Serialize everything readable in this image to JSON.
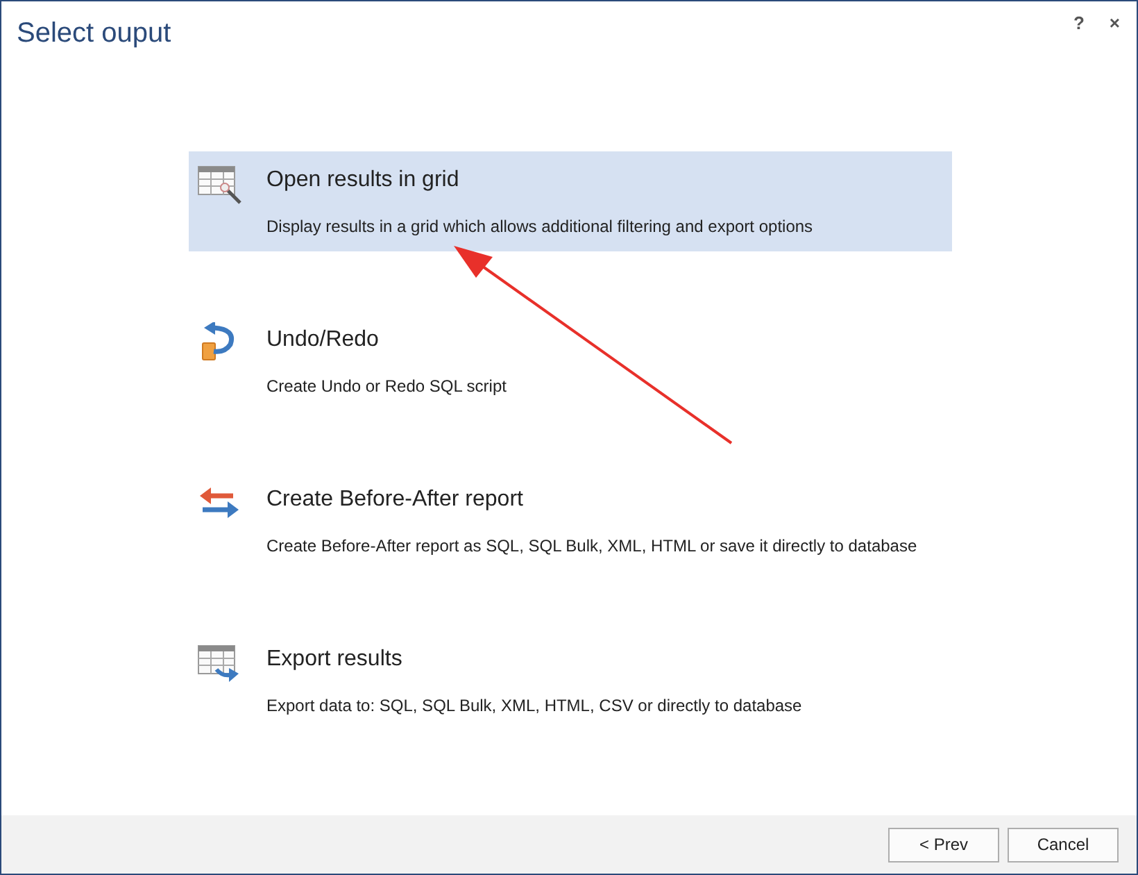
{
  "window": {
    "title": "Select ouput",
    "help": "?",
    "close": "×"
  },
  "options": [
    {
      "kind": "grid",
      "title": "Open results in grid",
      "description": "Display results in a grid which allows additional filtering and export options",
      "selected": true
    },
    {
      "kind": "undo",
      "title": "Undo/Redo",
      "description": "Create Undo or Redo SQL script",
      "selected": false
    },
    {
      "kind": "compare",
      "title": "Create Before-After report",
      "description": "Create Before-After report as SQL, SQL Bulk, XML, HTML or save it directly to database",
      "selected": false
    },
    {
      "kind": "export",
      "title": "Export results",
      "description": "Export data to: SQL, SQL Bulk, XML, HTML, CSV or directly to database",
      "selected": false
    }
  ],
  "buttons": [
    {
      "label": "< Prev"
    },
    {
      "label": "Cancel"
    }
  ]
}
